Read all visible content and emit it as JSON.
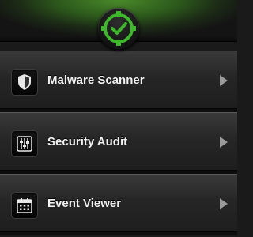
{
  "header": {
    "logo_icon": "shield-check-icon",
    "accent_color": "#4a8a2a"
  },
  "menu": {
    "items": [
      {
        "label": "Malware Scanner",
        "icon": "shield-icon"
      },
      {
        "label": "Security Audit",
        "icon": "sliders-icon"
      },
      {
        "label": "Event Viewer",
        "icon": "calendar-icon"
      }
    ]
  }
}
